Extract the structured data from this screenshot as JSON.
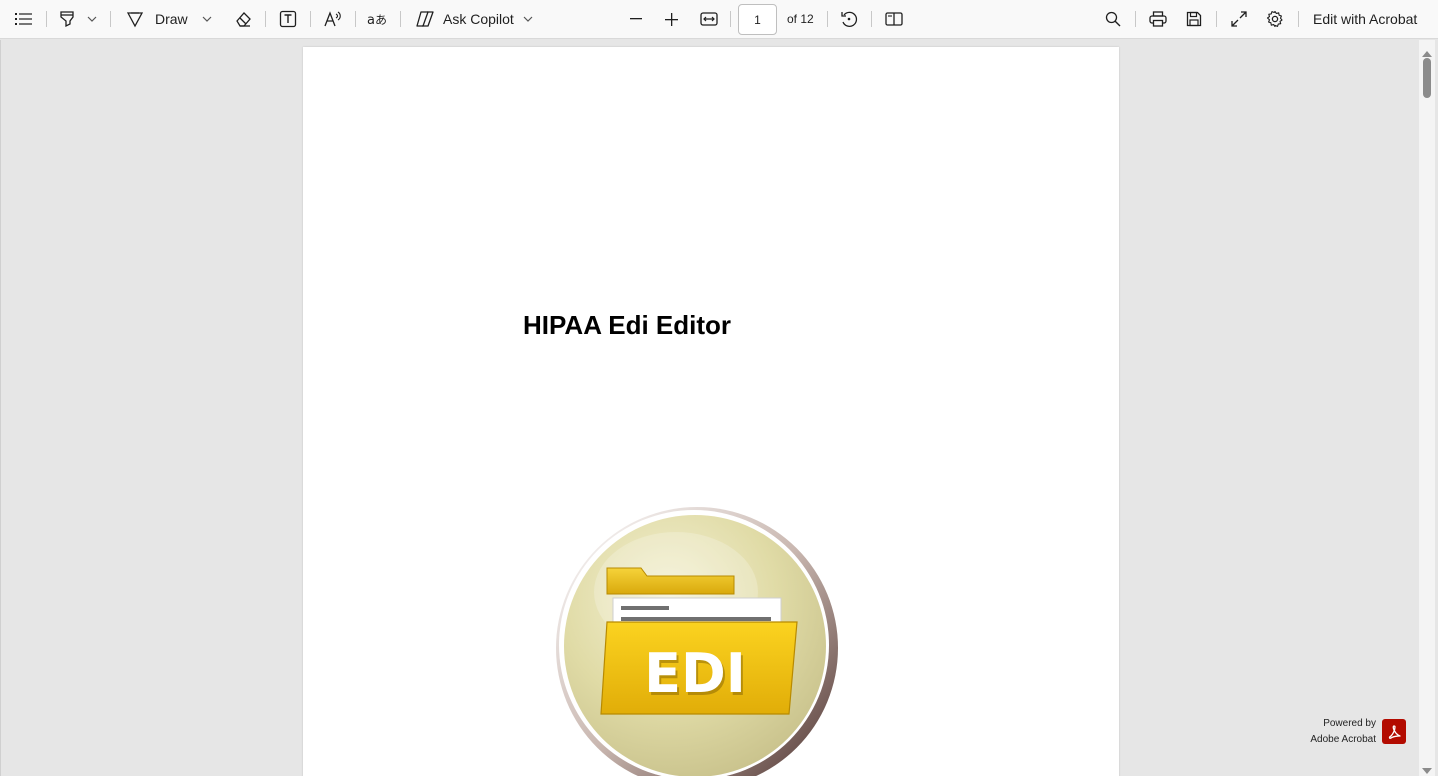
{
  "toolbar": {
    "contents_icon": "list-icon",
    "highlight_icon": "highlighter-icon",
    "draw_label": "Draw",
    "erase_icon": "eraser-icon",
    "text_icon": "text-box-icon",
    "read_aloud_icon": "read-aloud-icon",
    "translate_icon": "translate-icon",
    "copilot_label": "Ask Copilot",
    "zoom_out_icon": "minus-icon",
    "zoom_in_icon": "plus-icon",
    "fit_icon": "fit-width-icon",
    "page_number": "1",
    "page_total": "of 12",
    "rotate_icon": "rotate-icon",
    "page_view_icon": "page-view-icon",
    "search_icon": "search-icon",
    "print_icon": "print-icon",
    "save_icon": "save-icon",
    "fullscreen_icon": "expand-icon",
    "settings_icon": "gear-icon",
    "edit_acrobat_label": "Edit with Acrobat"
  },
  "document": {
    "title": "HIPAA Edi Editor",
    "logo_text": "EDI"
  },
  "footer": {
    "powered_line1": "Powered by",
    "powered_line2": "Adobe Acrobat"
  },
  "colors": {
    "toolbar_bg": "#f9f9f9",
    "viewer_bg": "#e6e6e6",
    "acrobat_red": "#b30b00",
    "folder_yellow": "#f2c21b"
  }
}
